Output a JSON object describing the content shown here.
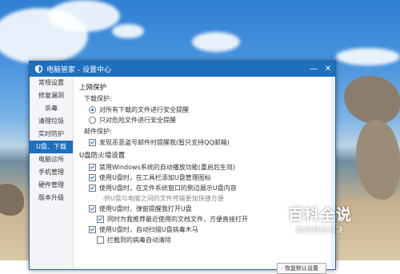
{
  "window": {
    "title": "电脑管家 - 设置中心",
    "minimize_glyph": "—",
    "close_glyph": "✕",
    "accent": "#1e6fbe"
  },
  "sidebar": {
    "items": [
      {
        "label": "常规设置",
        "active": false
      },
      {
        "label": "修复漏洞",
        "active": false
      },
      {
        "label": "杀毒",
        "active": false
      },
      {
        "label": "清理垃圾",
        "active": false
      },
      {
        "label": "实时防护",
        "active": false
      },
      {
        "label": "U盘、下载",
        "active": true
      },
      {
        "label": "电脑诊所",
        "active": false
      },
      {
        "label": "手机管理",
        "active": false
      },
      {
        "label": "硬件管理",
        "active": false
      },
      {
        "label": "版本升级",
        "active": false
      }
    ]
  },
  "content": {
    "section1_title": "上网保护",
    "download_label": "下载保护:",
    "opt_all_downloads": "对所有下载的文件进行安全提醒",
    "opt_risky_only": "只对危险文件进行安全提醒",
    "mail_label": "邮件保护:",
    "opt_mail_warn": "发现恶意盗号邮件时提醒我(暂只支持QQ邮箱)",
    "section2_title": "U盘防火墙设置",
    "opt_disable_autoplay": "禁用Windows系统的自动播放功能(重启后生效)",
    "opt_tray_icon": "使用U盘时，在工具栏添加U盘管理图标",
    "opt_explorer_content": "使用U盘时，在文件系统窗口的侧边展示U盘内容",
    "note_explorer": "-供U盘与电脑之间的文件传输更加快捷方便",
    "opt_popup": "使用U盘时，弹窗提醒我打开U盘",
    "opt_recent_files": "同时为我推荐最近使用的文档文件，方便直接打开",
    "opt_auto_scan": "使用U盘时，自动扫描U盘病毒木马",
    "opt_auto_clean": "拦截到的病毒自动清除",
    "bottom_button": "恢复默认设置"
  },
  "watermark": {
    "big": "百科全说",
    "small": "助你轻松解决"
  }
}
